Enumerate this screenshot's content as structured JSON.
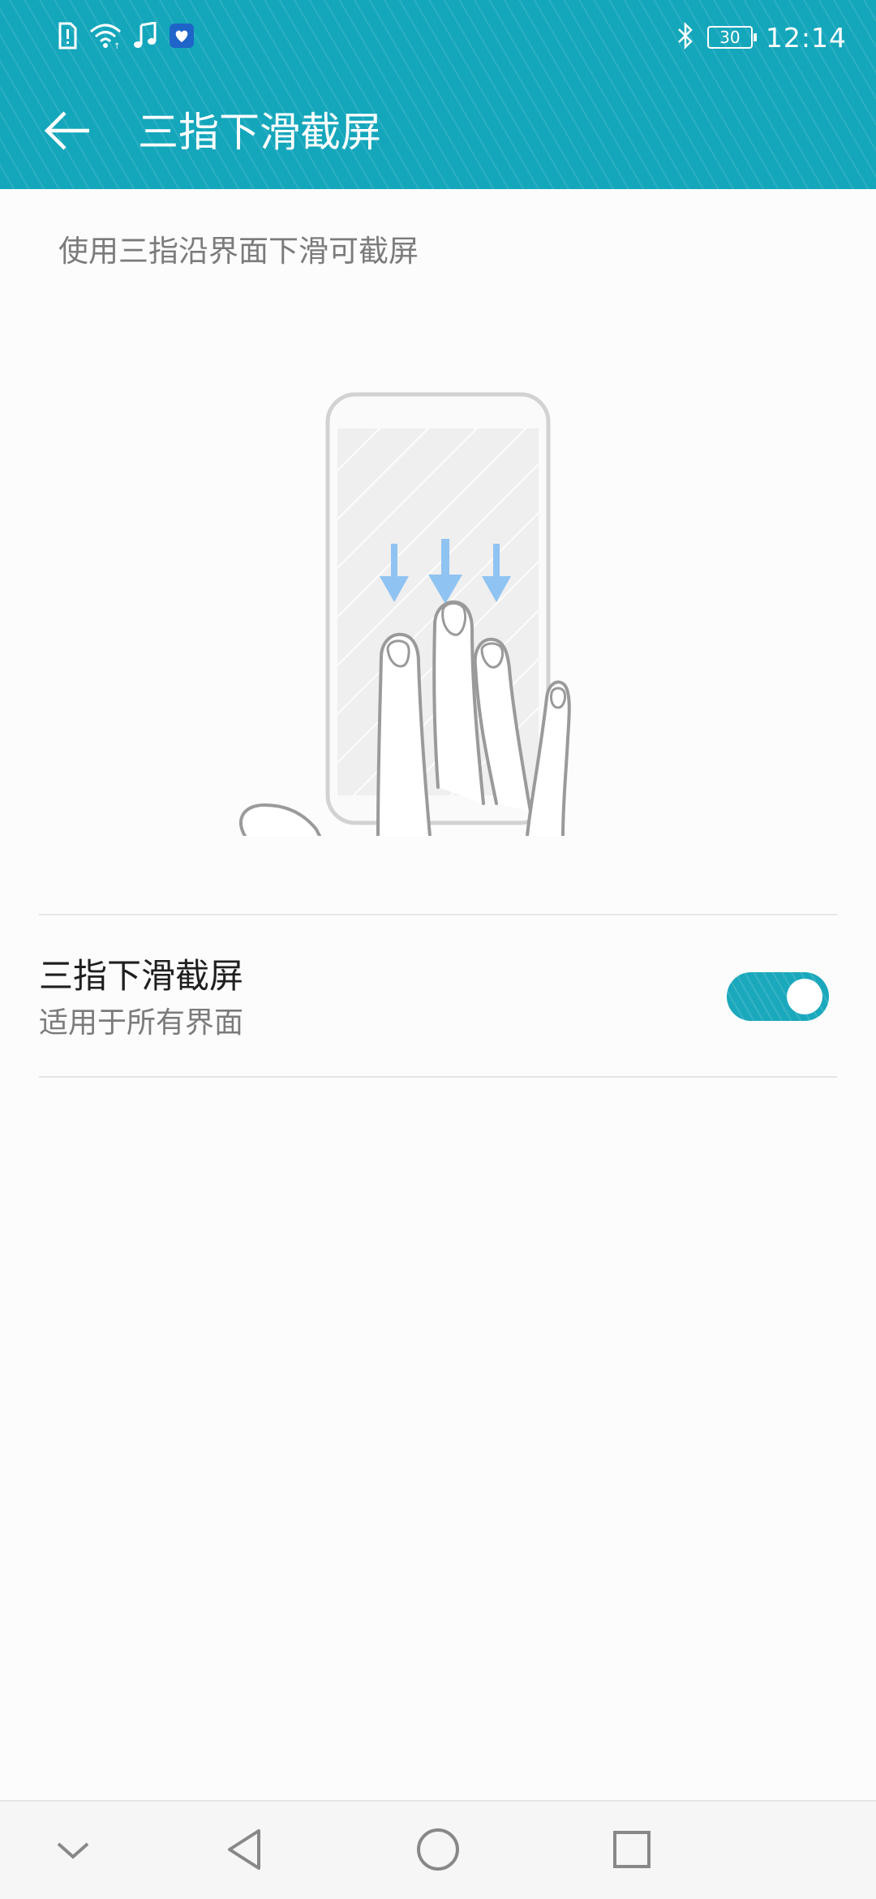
{
  "status_bar": {
    "time": "12:14",
    "battery_level": "30",
    "left_icons": [
      "sim-alert-icon",
      "wifi-icon",
      "music-note-icon",
      "app-notification-icon"
    ],
    "right_icons": [
      "bluetooth-icon",
      "battery-icon"
    ]
  },
  "header": {
    "title": "三指下滑截屏",
    "back_icon": "back-arrow-icon"
  },
  "main": {
    "description": "使用三指沿界面下滑可截屏",
    "illustration_icon": "three-finger-swipe-illustration",
    "setting": {
      "title": "三指下滑截屏",
      "subtitle": "适用于所有界面",
      "enabled": true
    }
  },
  "nav_bar": {
    "buttons": [
      "collapse-chevron-icon",
      "back-triangle-icon",
      "home-circle-icon",
      "recents-square-icon"
    ]
  },
  "colors": {
    "accent": "#14a6bb",
    "background": "#fcfcfc",
    "primary_text": "#1f1f1f",
    "secondary_text": "#7b7b7b",
    "arrow_blue": "#8fc3f2"
  }
}
